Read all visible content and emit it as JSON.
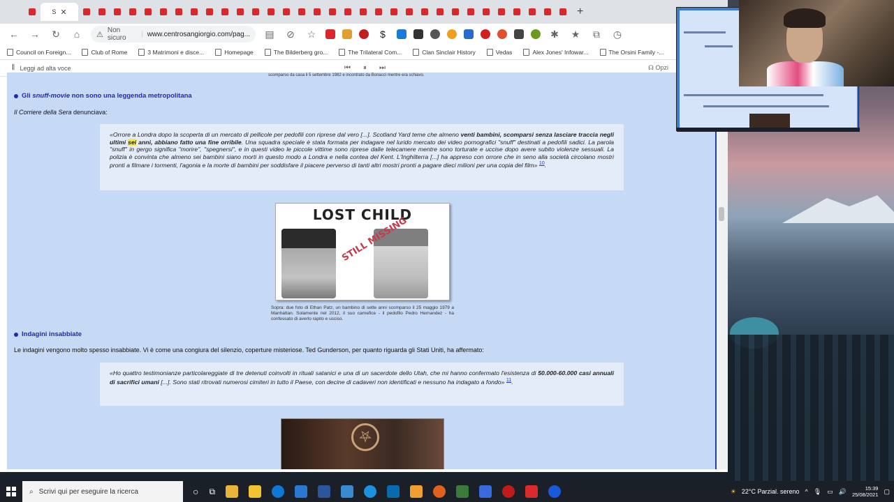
{
  "browser": {
    "active_tab_label": "S",
    "tab_count": 34,
    "new_tab_label": "+",
    "address": {
      "security_label": "Non sicuro",
      "url": "www.centrosangiorgio.com/pag..."
    },
    "bookmarks": [
      "Council on Foreign...",
      "Club of Rome",
      "3 Matrimoni e disce...",
      "Homepage",
      "The Bilderberg gro...",
      "The Trilateral Com...",
      "Clan Sinclair History",
      "Vedas",
      "Alex Jones' Infowar...",
      "The Orsini Family -..."
    ],
    "read_aloud": {
      "label": "Leggi ad alta voce",
      "options_label": "Opzi"
    }
  },
  "article": {
    "top_snippet": "Sopra: fotografie di ragazzini spariti ed essi Bonacci. A sinistra il ragazzo è Johnny Gosch, un dodicenne scomparso da casa il 5 settembre 1982 e incontrato da Bonacci mentre era schiavo.",
    "section1": {
      "title_prefix": "Gli ",
      "title_em": "snuff-movie",
      "title_suffix": " non sono una leggenda metropolitana"
    },
    "intro1_em": "Il Corriere della Sera",
    "intro1_rest": " denunciava:",
    "quote1": {
      "p1": "«Orrore a Londra dopo la scoperta di un mercato di pellicole per pedofili con riprese dal vero [...]. Scotland Yard teme che almeno ",
      "b1": "venti bambini, scomparsi senza lasciare traccia negli ultimi ",
      "highlight": "sei",
      "b2": " anni, abbiano fatto una fine orribile",
      "p2": ". Una squadra speciale è stata formata per indagare nel lurido mercato dei video pornografici \"snuff\" destinati a pedofili sadici. La parola \"snuff\" in gergo significa \"morire\", \"spegnersi\", e in questi video le piccole vittime sono riprese dalle telecamere mentre sono torturate e uccise dopo avere subito violenze sessuali. La polizia è convinta che almeno sei bambini siano morti in questo modo a Londra e nella contea del Kent. L'Inghilterra [...] ha appreso con orrore che in seno alla società circolano mostri pronti a filmare i tormenti, l'agonia e la morte di bambini per soddisfare il piacere perverso di tanti altri mostri pronti a pagare dieci milioni per una copia del film»",
      "note": "10"
    },
    "photo1": {
      "headline": "LOST CHILD",
      "stamp": "STILL MISSING",
      "caption": "Sopra: due foto di Ethan Patz, un bambino di sette anni scomparso il 25 maggio 1979 a Manhattan. Solamente nel 2012, il suo carnefice - il pedofilo Pedro Hernandez - ha confessato di averlo rapito e ucciso."
    },
    "section2": {
      "title": "Indagini insabbiate"
    },
    "intro2": "Le indagini vengono molto spesso insabbiate. Vi è come una congiura del silenzio, coperture misteriose. Ted Gunderson, per quanto riguarda gli Stati Uniti, ha affermato:",
    "quote2": {
      "p1": "«Ho quattro testimonianze particolareggiate di tre detenuti coinvolti in rituali satanici e una di un sacerdote dello Utah, che mi hanno confermato l'esistenza di ",
      "b1": "50.000-60.000 casi annuali di sacrifici umani",
      "p2": " [...]. Sono stati ritrovati numerosi cimiteri in tutto il Paese, con decine di cadaveri non identificati e nessuno ha indagato a fondo»",
      "note": "11"
    }
  },
  "taskbar": {
    "search_placeholder": "Scrivi qui per eseguire la ricerca",
    "weather": "22°C  Parzial. sereno",
    "time": "15:39",
    "date": "25/08/2021"
  },
  "colors": {
    "page_bg": "#c6d9f5",
    "heading": "#1f2bb6",
    "quote_bg": "#e4ecfa",
    "highlight": "#f6e84a"
  }
}
